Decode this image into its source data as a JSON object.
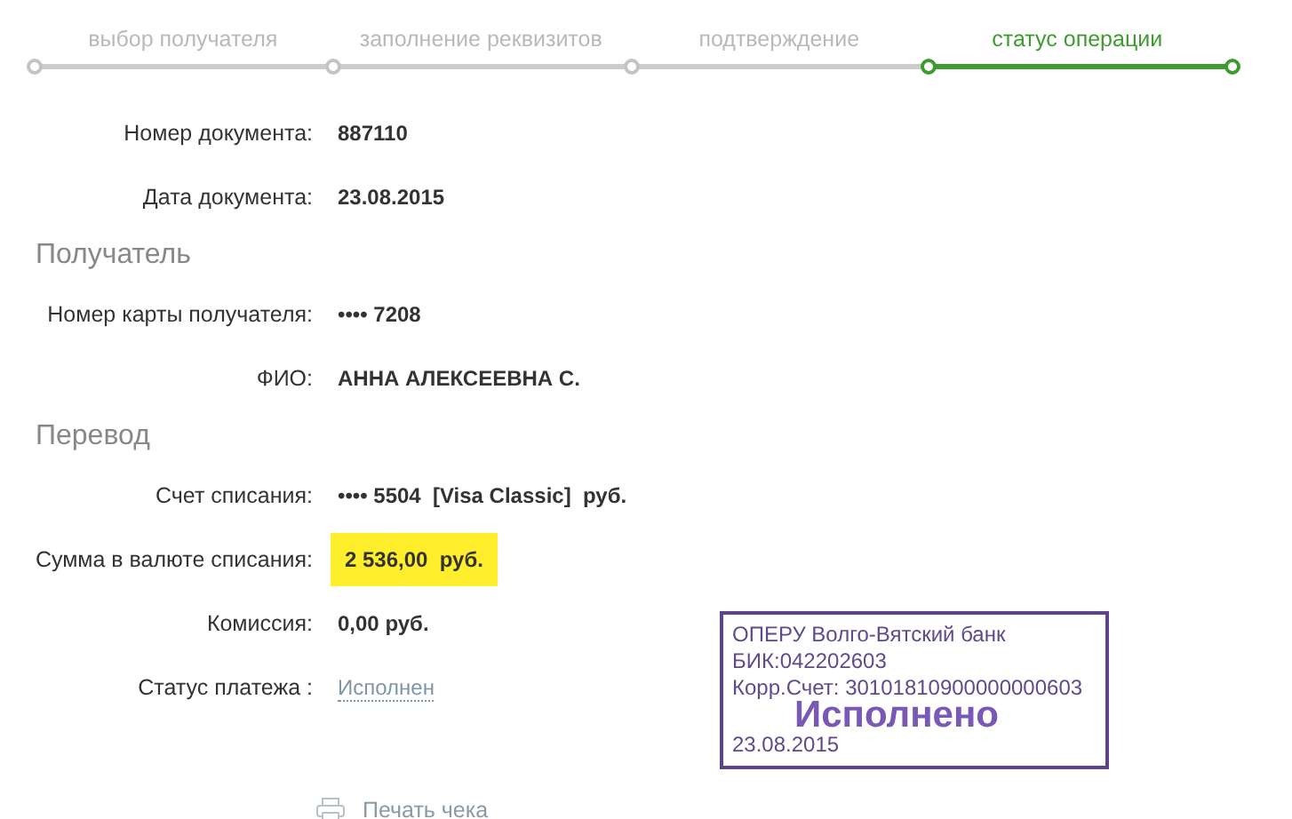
{
  "steps": [
    {
      "label": "выбор получателя",
      "selected": false
    },
    {
      "label": "заполнение реквизитов",
      "selected": false
    },
    {
      "label": "подтверждение",
      "selected": false
    },
    {
      "label": "статус операции",
      "selected": true
    }
  ],
  "sections": [
    {
      "fields": [
        {
          "label": "Номер документа:",
          "value": "887110",
          "kind": "plain"
        },
        {
          "label": "Дата документа:",
          "value": "23.08.2015",
          "kind": "plain"
        }
      ]
    },
    {
      "title": "Получатель",
      "fields": [
        {
          "label": "Номер карты получателя:",
          "value": "•••• 7208",
          "kind": "plain"
        },
        {
          "label": "ФИО:",
          "value": "АННА АЛЕКСЕЕВНА С.",
          "kind": "plain"
        }
      ]
    },
    {
      "title": "Перевод",
      "fields": [
        {
          "label": "Счет списания:",
          "value": "•••• 5504  [Visa Classic]  руб.",
          "kind": "plain"
        },
        {
          "label": "Сумма в валюте списания:",
          "value": "2 536,00  руб.",
          "kind": "highlight"
        },
        {
          "label": "Комиссия:",
          "value": "0,00 руб.",
          "kind": "plain"
        },
        {
          "label": "Статус платежа :",
          "value": "Исполнен",
          "kind": "link"
        }
      ]
    }
  ],
  "stamp": {
    "lines": [
      "ОПЕРУ Волго-Вятский банк",
      "БИК:042202603",
      "Корр.Счет: 30101810900000000603"
    ],
    "status": "Исполнено",
    "date": "23.08.2015"
  },
  "print_link": "Печать чека"
}
